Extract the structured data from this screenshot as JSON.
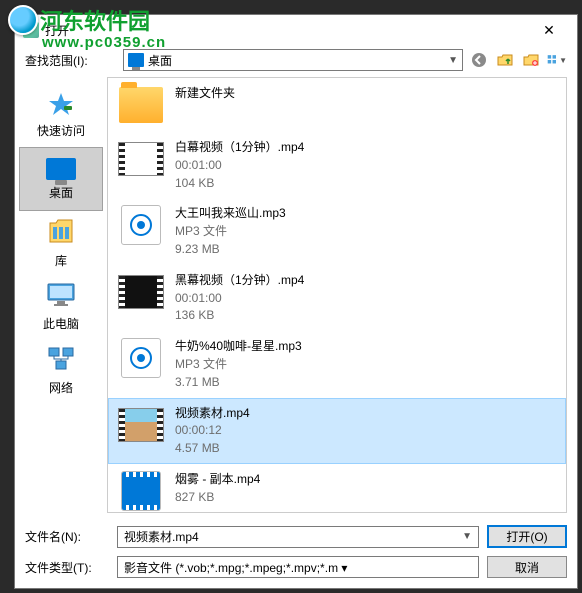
{
  "watermark": {
    "text": "河东软件园",
    "url": "www.pc0359.cn"
  },
  "dialog": {
    "title": "打开",
    "lookin_label": "查找范围(I):",
    "lookin_value": "桌面",
    "filename_label": "文件名(N):",
    "filename_value": "视频素材.mp4",
    "filetype_label": "文件类型(T):",
    "filetype_value": "影音文件 (*.vob;*.mpg;*.mpeg;*.mpv;*.m ▾",
    "open_btn": "打开(O)",
    "cancel_btn": "取消"
  },
  "places": {
    "quick": "快速访问",
    "desktop": "桌面",
    "libraries": "库",
    "thispc": "此电脑",
    "network": "网络"
  },
  "files": [
    {
      "name": "新建文件夹",
      "line2": "",
      "line3": ""
    },
    {
      "name": "白幕视频（1分钟）.mp4",
      "line2": "00:01:00",
      "line3": "104 KB"
    },
    {
      "name": "大王叫我来巡山.mp3",
      "line2": "MP3 文件",
      "line3": "9.23 MB"
    },
    {
      "name": "黑幕视频（1分钟）.mp4",
      "line2": "00:01:00",
      "line3": "136 KB"
    },
    {
      "name": "牛奶%40咖啡-星星.mp3",
      "line2": "MP3 文件",
      "line3": "3.71 MB"
    },
    {
      "name": "视频素材.mp4",
      "line2": "00:00:12",
      "line3": "4.57 MB"
    },
    {
      "name": "烟雾 - 副本.mp4",
      "line2": "827 KB",
      "line3": ""
    }
  ]
}
